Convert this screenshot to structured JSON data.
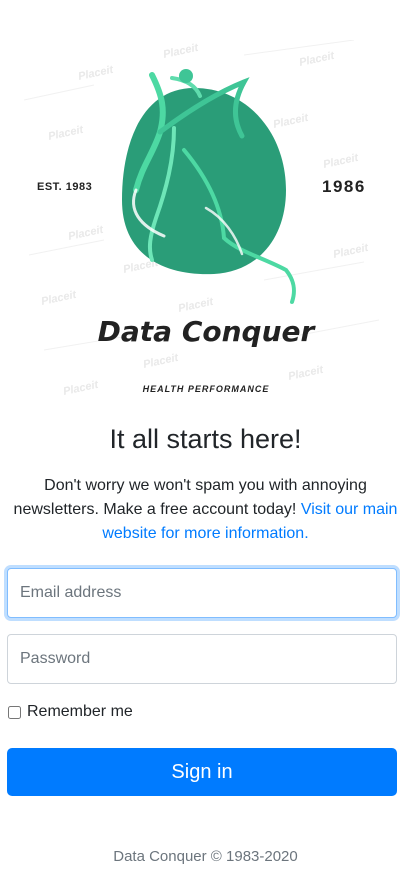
{
  "logo": {
    "est_label": "EST. 1983",
    "year_label": "1986",
    "brand_name": "Data Conquer",
    "tagline": "HEALTH PERFORMANCE",
    "watermark_text": "Placeit",
    "colors": {
      "leaf": "#2a9d78",
      "accent": "#4dd9a3",
      "text": "#222222"
    }
  },
  "headline": "It all starts here!",
  "lead": {
    "text": "Don't worry we won't spam you with annoying newsletters. Make a free account today! ",
    "link_text": "Visit our main website for more information."
  },
  "form": {
    "email_placeholder": "Email address",
    "password_placeholder": "Password",
    "remember_label": "Remember me",
    "remember_checked": false,
    "signin_label": "Sign in"
  },
  "footer": "Data Conquer © 1983-2020",
  "colors": {
    "primary": "#007bff",
    "focus_ring": "#80bdff",
    "muted": "#6c757d"
  }
}
